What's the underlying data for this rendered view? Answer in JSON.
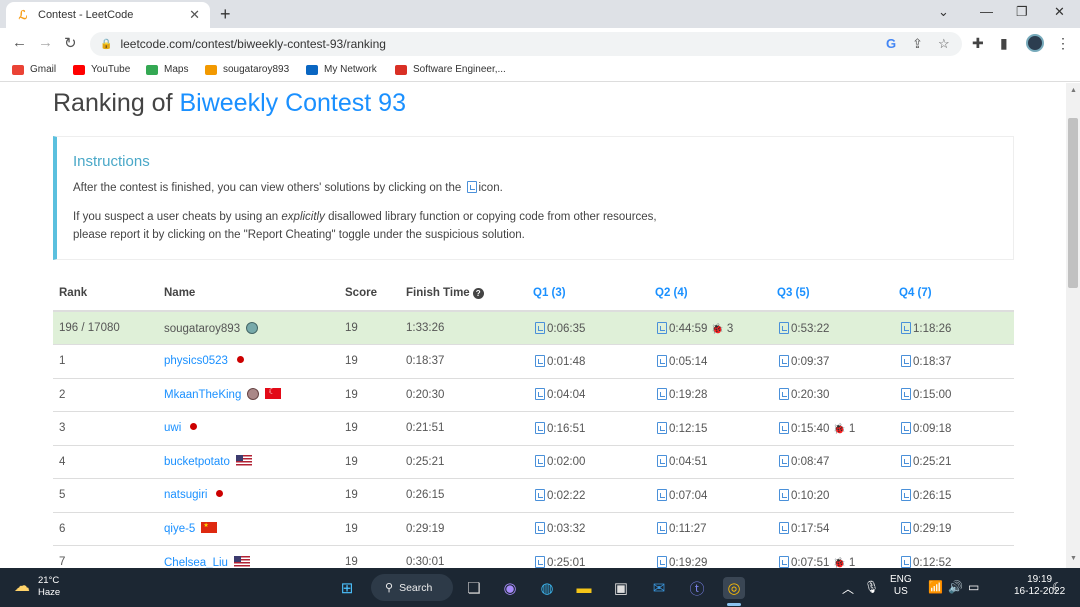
{
  "browser": {
    "tab_title": "Contest - LeetCode",
    "url": "leetcode.com/contest/biweekly-contest-93/ranking",
    "new_tab": "+",
    "bookmarks": [
      {
        "label": "Gmail",
        "color": "#ea4335"
      },
      {
        "label": "YouTube",
        "color": "#ff0000"
      },
      {
        "label": "Maps",
        "color": "#34a853"
      },
      {
        "label": "sougataroy893",
        "color": "#f29900"
      },
      {
        "label": "My Network",
        "color": "#0a66c2"
      },
      {
        "label": "Software Engineer,...",
        "color": "#d93025"
      }
    ]
  },
  "page": {
    "title_prefix": "Ranking of",
    "title_link": "Biweekly Contest 93",
    "instructions": {
      "heading": "Instructions",
      "line1_pre": "After the contest is finished, you can view others' solutions by clicking on the",
      "line1_post": "icon.",
      "line2_a": "If you suspect a user cheats by using an",
      "line2_em": "explicitly",
      "line2_b": "disallowed library function or copying code from other resources,",
      "line3": "please report it by clicking on the \"Report Cheating\" toggle under the suspicious solution."
    },
    "table": {
      "headers": {
        "rank": "Rank",
        "name": "Name",
        "score": "Score",
        "finish": "Finish Time",
        "q1": "Q1 (3)",
        "q2": "Q2 (4)",
        "q3": "Q3 (5)",
        "q4": "Q4 (7)"
      },
      "rows": [
        {
          "rank": "196 / 17080",
          "name": "sougataroy893",
          "score": "19",
          "finish": "1:33:26",
          "q1": "0:06:35",
          "q2": "0:44:59",
          "q2_bugs": "3",
          "q3": "0:53:22",
          "q4": "1:18:26"
        },
        {
          "rank": "1",
          "name": "physics0523",
          "score": "19",
          "finish": "0:18:37",
          "q1": "0:01:48",
          "q2": "0:05:14",
          "q3": "0:09:37",
          "q4": "0:18:37"
        },
        {
          "rank": "2",
          "name": "MkaanTheKing",
          "score": "19",
          "finish": "0:20:30",
          "q1": "0:04:04",
          "q2": "0:19:28",
          "q3": "0:20:30",
          "q4": "0:15:00"
        },
        {
          "rank": "3",
          "name": "uwi",
          "score": "19",
          "finish": "0:21:51",
          "q1": "0:16:51",
          "q2": "0:12:15",
          "q3": "0:15:40",
          "q3_bugs": "1",
          "q4": "0:09:18"
        },
        {
          "rank": "4",
          "name": "bucketpotato",
          "score": "19",
          "finish": "0:25:21",
          "q1": "0:02:00",
          "q2": "0:04:51",
          "q3": "0:08:47",
          "q4": "0:25:21"
        },
        {
          "rank": "5",
          "name": "natsugiri",
          "score": "19",
          "finish": "0:26:15",
          "q1": "0:02:22",
          "q2": "0:07:04",
          "q3": "0:10:20",
          "q4": "0:26:15"
        },
        {
          "rank": "6",
          "name": "qiye-5",
          "score": "19",
          "finish": "0:29:19",
          "q1": "0:03:32",
          "q2": "0:11:27",
          "q3": "0:17:54",
          "q4": "0:29:19"
        },
        {
          "rank": "7",
          "name": "Chelsea_Liu",
          "score": "19",
          "finish": "0:30:01",
          "q1": "0:25:01",
          "q2": "0:19:29",
          "q3": "0:07:51",
          "q3_bugs": "1",
          "q4": "0:12:52"
        }
      ]
    }
  },
  "taskbar": {
    "temp": "21°C",
    "weather": "Haze",
    "search": "Search",
    "lang1": "ENG",
    "lang2": "US",
    "time": "19:19",
    "date": "16-12-2022"
  }
}
